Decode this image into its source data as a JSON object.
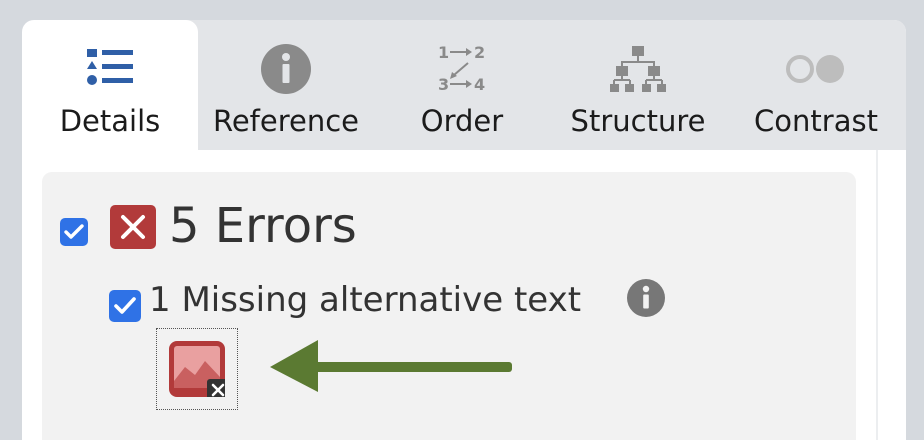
{
  "tabs": [
    {
      "label": "Details",
      "icon": "details-list-icon",
      "active": true
    },
    {
      "label": "Reference",
      "icon": "info-circle-icon",
      "active": false
    },
    {
      "label": "Order",
      "icon": "order-arrows-icon",
      "active": false,
      "icon_text": [
        "1",
        "2",
        "3",
        "4"
      ]
    },
    {
      "label": "Structure",
      "icon": "structure-tree-icon",
      "active": false
    },
    {
      "label": "Contrast",
      "icon": "contrast-circles-icon",
      "active": false
    }
  ],
  "summary": {
    "errors_label": "5 Errors",
    "errors_checked": true
  },
  "issue": {
    "label": "1 Missing alternative text",
    "checked": true
  },
  "colors": {
    "accent": "#2f72e6",
    "error": "#b23a3a",
    "arrow": "#5b7a32",
    "icon_gray": "#8a8a8a",
    "details_icon": "#2f5fa7"
  }
}
